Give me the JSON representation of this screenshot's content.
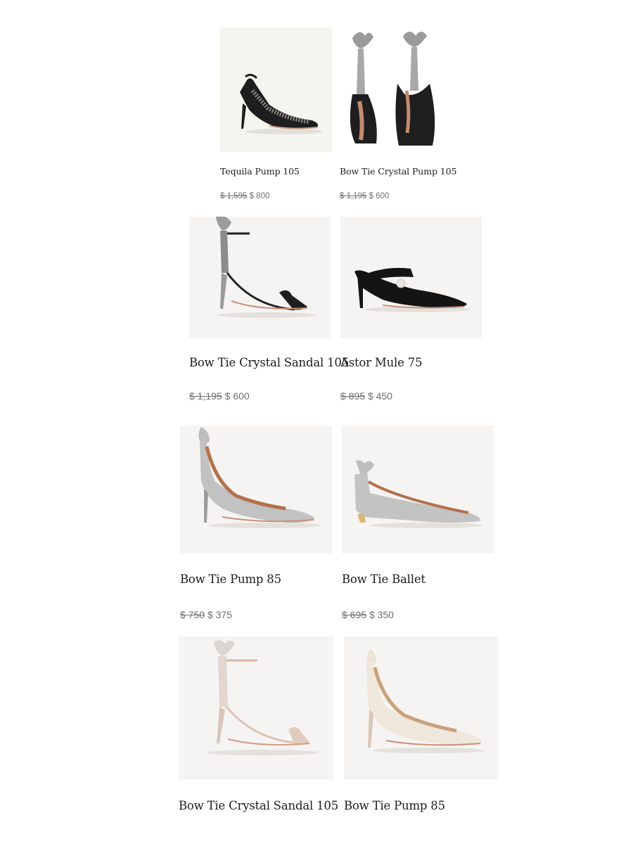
{
  "products": [
    {
      "name": "Tequila Pump 105",
      "original_price": "$ 1,595",
      "sale_price": "$ 800",
      "image": "black-crystal-slingback-pump",
      "background": "#f5f5f0"
    },
    {
      "name": "Bow Tie Crystal Pump 105",
      "original_price": "$ 1,195",
      "sale_price": "$ 600",
      "image": "black-pump-pair-crystal-bow",
      "background": "#ffffff"
    },
    {
      "name": "Bow Tie Crystal Sandal 105",
      "original_price": "$ 1,195",
      "sale_price": "$ 600",
      "image": "black-sandal-crystal-bow",
      "background": "#f6f4f2"
    },
    {
      "name": "Astor Mule 75",
      "original_price": "$ 895",
      "sale_price": "$ 450",
      "image": "black-velvet-mule-pearl",
      "background": "#f6f4f2"
    },
    {
      "name": "Bow Tie Pump 85",
      "original_price": "$ 750",
      "sale_price": "$ 375",
      "image": "grey-suede-bow-pump",
      "background": "#f6f4f2"
    },
    {
      "name": "Bow Tie Ballet",
      "original_price": "$ 695",
      "sale_price": "$ 350",
      "image": "grey-suede-bow-flat",
      "background": "#f6f4f2"
    },
    {
      "name": "Bow Tie Crystal Sandal 105",
      "image": "nude-satin-bow-sandal",
      "background": "#f6f4f2"
    },
    {
      "name": "Bow Tie Pump 85",
      "image": "cream-bow-pump",
      "background": "#f6f4f2"
    }
  ]
}
